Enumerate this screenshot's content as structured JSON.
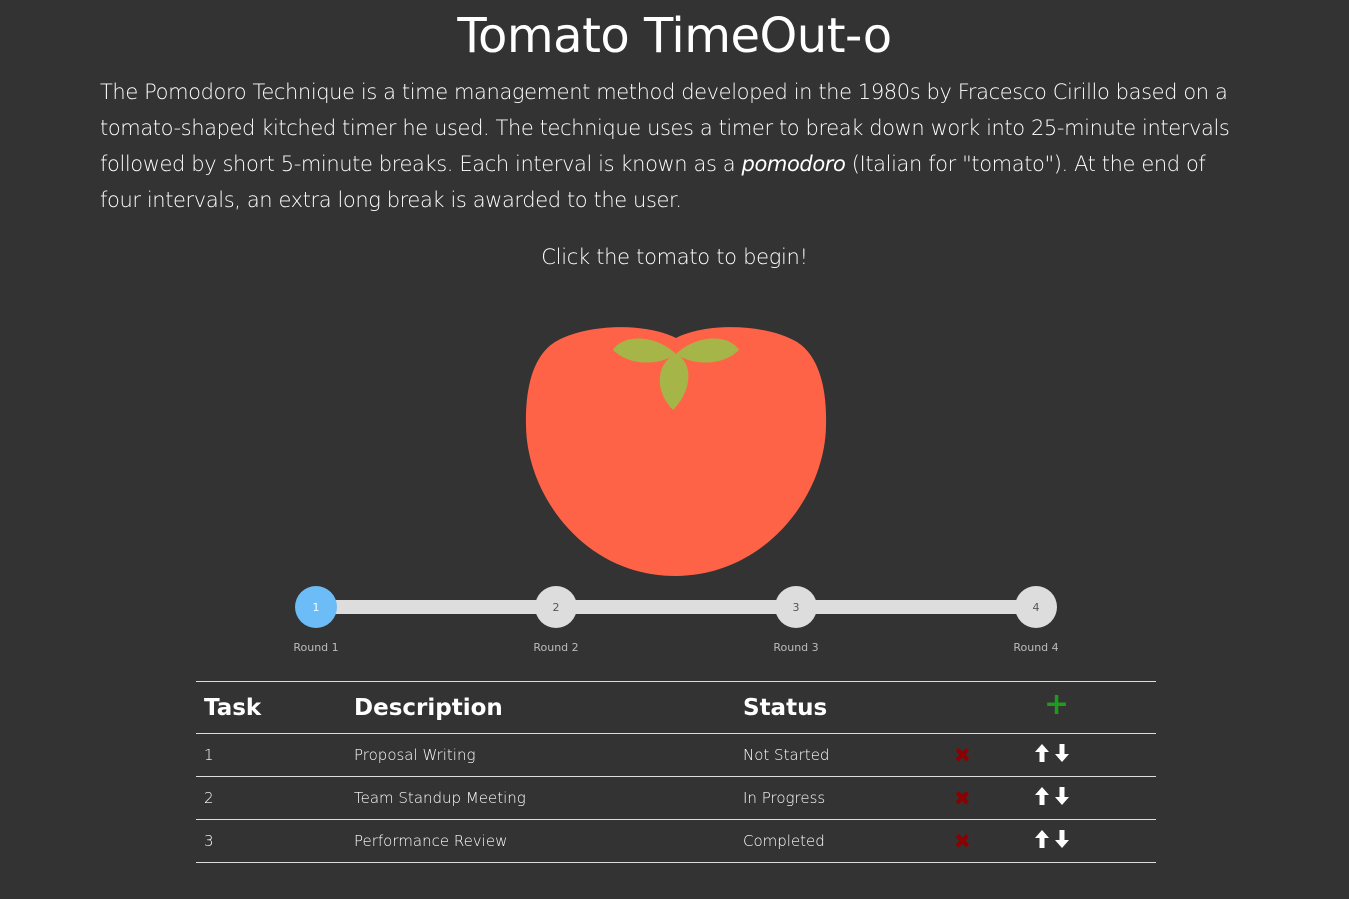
{
  "title": "Tomato TimeOut-o",
  "intro": {
    "before_em": "The Pomodoro Technique is a time management method developed in the 1980s by Fracesco Cirillo based on a tomato-shaped kitched timer he used. The technique uses a timer to break down work into 25-minute intervals followed by short 5-minute breaks. Each interval is known as a ",
    "em": "pomodoro",
    "after_em": " (Italian for \"tomato\"). At the end of four intervals, an extra long break is awarded to the user."
  },
  "cta": "Click the tomato to begin!",
  "colors": {
    "background": "#333333",
    "tomato": "#ff6347",
    "leaves": "#a6b547",
    "active_round": "#6bbcf7",
    "inactive_round": "#dddddd",
    "add": "#1e9a1e",
    "delete": "#8b0000"
  },
  "rounds": [
    {
      "number": "1",
      "label": "Round 1",
      "active": true
    },
    {
      "number": "2",
      "label": "Round 2",
      "active": false
    },
    {
      "number": "3",
      "label": "Round 3",
      "active": false
    },
    {
      "number": "4",
      "label": "Round 4",
      "active": false
    }
  ],
  "table": {
    "headers": {
      "task": "Task",
      "description": "Description",
      "status": "Status"
    },
    "add_icon": "plus-icon",
    "delete_icon": "x-icon",
    "move_icons": [
      "arrow-up-icon",
      "arrow-down-icon"
    ],
    "rows": [
      {
        "task": "1",
        "description": "Proposal Writing",
        "status": "Not Started"
      },
      {
        "task": "2",
        "description": "Team Standup Meeting",
        "status": "In Progress"
      },
      {
        "task": "3",
        "description": "Performance Review",
        "status": "Completed"
      }
    ]
  }
}
